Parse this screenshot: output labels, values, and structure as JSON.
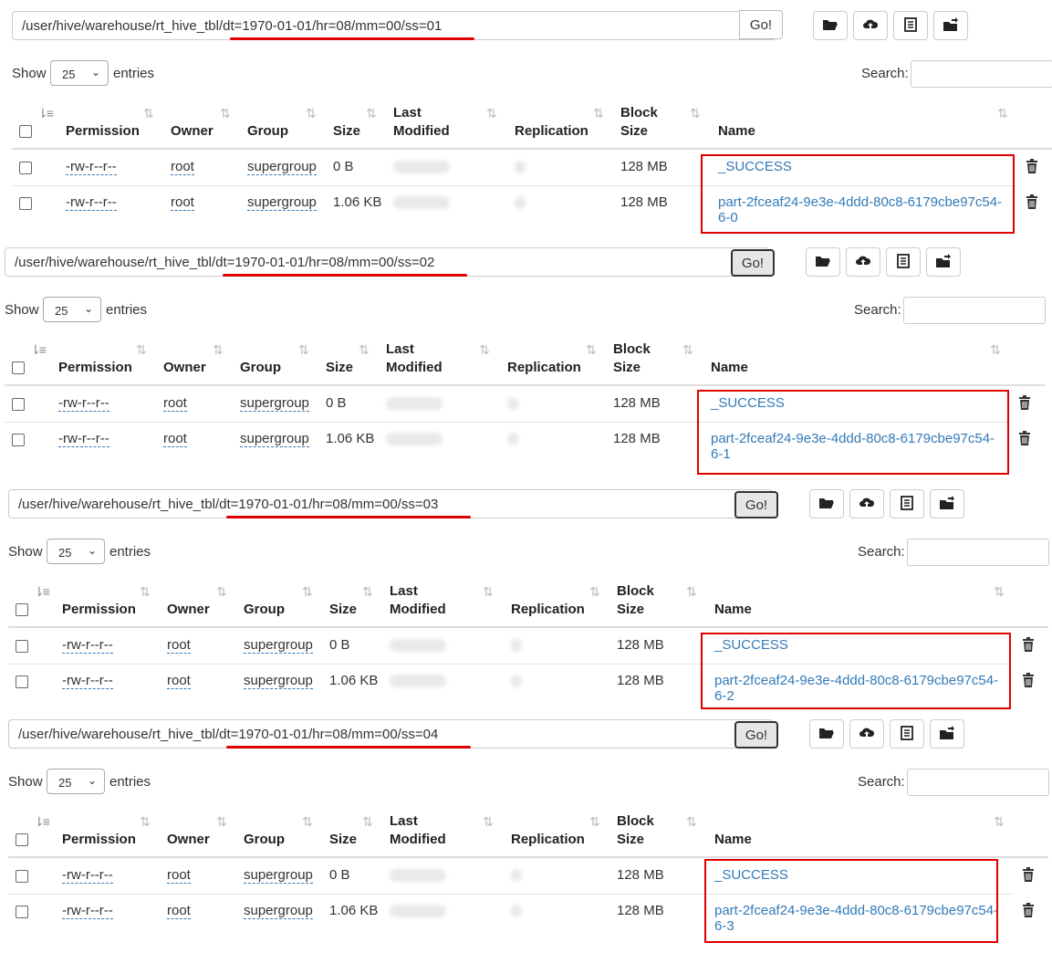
{
  "go_label": "Go!",
  "show_label": "Show",
  "entries_label": "entries",
  "search_label": "Search:",
  "page_size": "25",
  "columns": {
    "permission": "Permission",
    "owner": "Owner",
    "group": "Group",
    "size": "Size",
    "last_modified_1": "Last",
    "last_modified_2": "Modified",
    "replication": "Replication",
    "block_size_1": "Block",
    "block_size_2": "Size",
    "name": "Name"
  },
  "panels": [
    {
      "path": "/user/hive/warehouse/rt_hive_tbl/dt=1970-01-01/hr=08/mm=00/ss=01",
      "rows": [
        {
          "permission": "-rw-r--r--",
          "owner": "root",
          "group": "supergroup",
          "size": "0 B",
          "block_size": "128 MB",
          "name_1": "_SUCCESS",
          "name_2": ""
        },
        {
          "permission": "-rw-r--r--",
          "owner": "root",
          "group": "supergroup",
          "size": "1.06 KB",
          "block_size": "128 MB",
          "name_1": "part-2fceaf24-9e3e-4ddd-80c8-6179cbe97c54-",
          "name_2": "6-0"
        }
      ]
    },
    {
      "path": "/user/hive/warehouse/rt_hive_tbl/dt=1970-01-01/hr=08/mm=00/ss=02",
      "rows": [
        {
          "permission": "-rw-r--r--",
          "owner": "root",
          "group": "supergroup",
          "size": "0 B",
          "block_size": "128 MB",
          "name_1": "_SUCCESS",
          "name_2": ""
        },
        {
          "permission": "-rw-r--r--",
          "owner": "root",
          "group": "supergroup",
          "size": "1.06 KB",
          "block_size": "128 MB",
          "name_1": "part-2fceaf24-9e3e-4ddd-80c8-6179cbe97c54-",
          "name_2": "6-1"
        }
      ]
    },
    {
      "path": "/user/hive/warehouse/rt_hive_tbl/dt=1970-01-01/hr=08/mm=00/ss=03",
      "rows": [
        {
          "permission": "-rw-r--r--",
          "owner": "root",
          "group": "supergroup",
          "size": "0 B",
          "block_size": "128 MB",
          "name_1": "_SUCCESS",
          "name_2": ""
        },
        {
          "permission": "-rw-r--r--",
          "owner": "root",
          "group": "supergroup",
          "size": "1.06 KB",
          "block_size": "128 MB",
          "name_1": "part-2fceaf24-9e3e-4ddd-80c8-6179cbe97c54-",
          "name_2": "6-2"
        }
      ]
    },
    {
      "path": "/user/hive/warehouse/rt_hive_tbl/dt=1970-01-01/hr=08/mm=00/ss=04",
      "rows": [
        {
          "permission": "-rw-r--r--",
          "owner": "root",
          "group": "supergroup",
          "size": "0 B",
          "block_size": "128 MB",
          "name_1": "_SUCCESS",
          "name_2": ""
        },
        {
          "permission": "-rw-r--r--",
          "owner": "root",
          "group": "supergroup",
          "size": "1.06 KB",
          "block_size": "128 MB",
          "name_1": "part-2fceaf24-9e3e-4ddd-80c8-6179cbe97c54-",
          "name_2": "6-3"
        }
      ]
    }
  ],
  "colors": {
    "link": "#337ab7",
    "highlight": "#e00000"
  },
  "icons": [
    "folder-open-icon",
    "cloud-upload-icon",
    "list-icon",
    "move-folder-icon",
    "trash-icon",
    "sort-icon"
  ]
}
